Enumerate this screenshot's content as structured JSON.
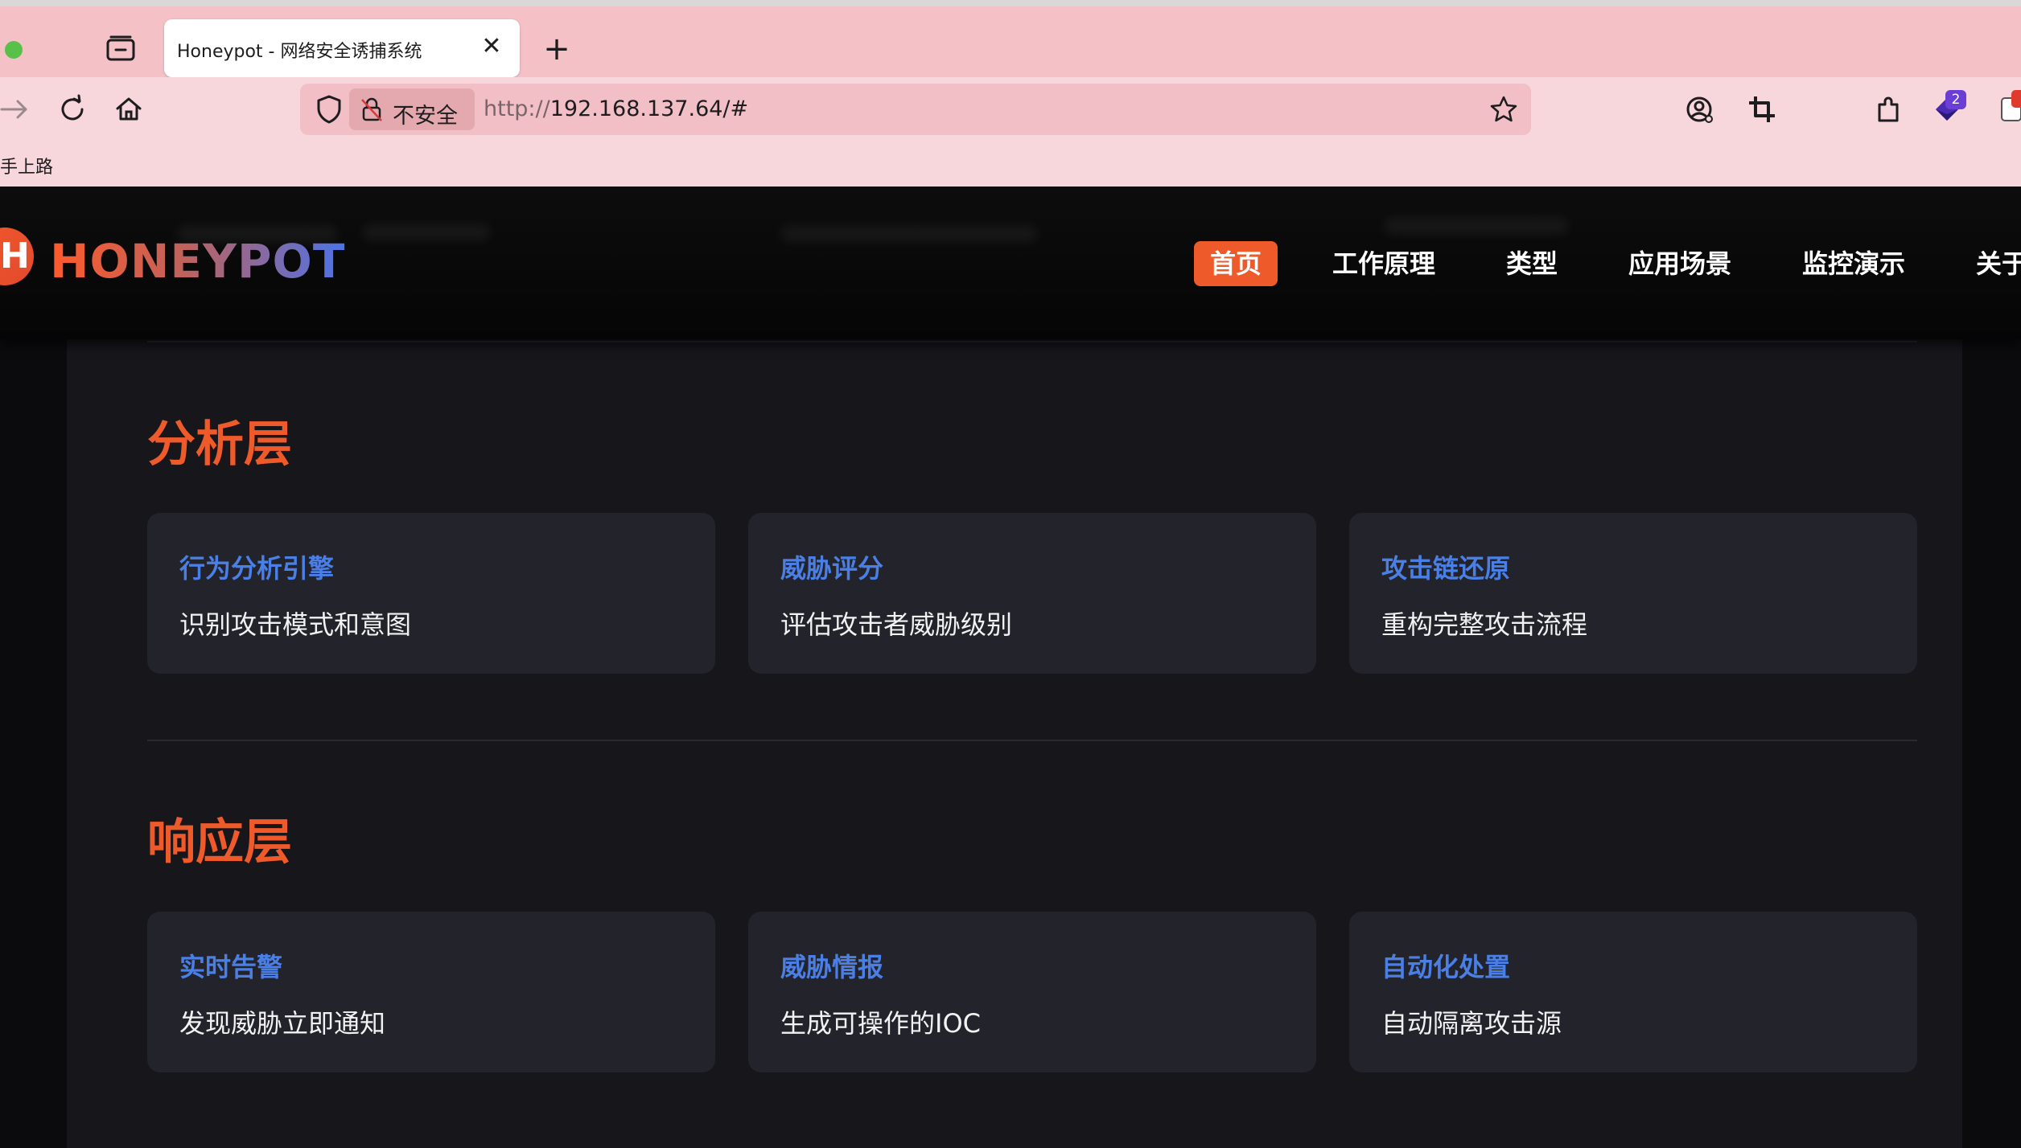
{
  "browser": {
    "tab_title": "Honeypot - 网络安全诱捕系统",
    "tab_close": "✕",
    "new_tab": "+",
    "security_label": "不安全",
    "url_protocol": "http://",
    "url_host": "192.168.137.64/#",
    "bookmark_fragment": "手上路",
    "extension_badge_count": "2"
  },
  "site": {
    "logo_letter": "H",
    "logo_text": "HONEYPOT",
    "nav": [
      {
        "label": "首页",
        "active": true
      },
      {
        "label": "工作原理",
        "active": false
      },
      {
        "label": "类型",
        "active": false
      },
      {
        "label": "应用场景",
        "active": false
      },
      {
        "label": "监控演示",
        "active": false
      },
      {
        "label": "关于",
        "active": false
      }
    ]
  },
  "layers": [
    {
      "title": "分析层",
      "cards": [
        {
          "title": "行为分析引擎",
          "desc": "识别攻击模式和意图"
        },
        {
          "title": "威胁评分",
          "desc": "评估攻击者威胁级别"
        },
        {
          "title": "攻击链还原",
          "desc": "重构完整攻击流程"
        }
      ]
    },
    {
      "title": "响应层",
      "cards": [
        {
          "title": "实时告警",
          "desc": "发现威胁立即通知"
        },
        {
          "title": "威胁情报",
          "desc": "生成可操作的IOC"
        },
        {
          "title": "自动化处置",
          "desc": "自动隔离攻击源"
        }
      ]
    }
  ],
  "colors": {
    "accent": "#ef5a2b",
    "card_title": "#4a7fe6",
    "card_bg": "#23232b",
    "panel_bg": "#16161b",
    "chrome_bg": "#f8d7dc"
  }
}
